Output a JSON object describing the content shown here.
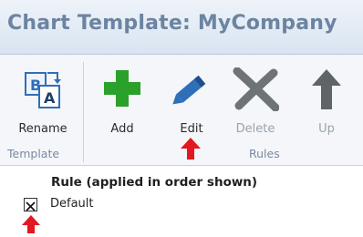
{
  "window": {
    "title": "Chart Template: MyCompany"
  },
  "ribbon": {
    "template_group": {
      "label": "Template",
      "buttons": [
        {
          "label": "Rename",
          "icon": "rename-icon",
          "enabled": true
        }
      ]
    },
    "rules_group": {
      "label": "Rules",
      "buttons": [
        {
          "label": "Add",
          "icon": "plus-icon",
          "enabled": true
        },
        {
          "label": "Edit",
          "icon": "pencil-icon",
          "enabled": true
        },
        {
          "label": "Delete",
          "icon": "x-icon",
          "enabled": false
        },
        {
          "label": "Up",
          "icon": "arrow-up-icon",
          "enabled": false
        }
      ]
    }
  },
  "rules": {
    "header": "Rule (applied in order shown)",
    "items": [
      {
        "label": "Default",
        "checked": true
      }
    ]
  },
  "colors": {
    "title": "#6c84a1",
    "add_green": "#2aa12a",
    "edit_blue": "#2f6fb8",
    "annotation_red": "#e2171f",
    "disabled_gray": "#9aa3ad"
  }
}
